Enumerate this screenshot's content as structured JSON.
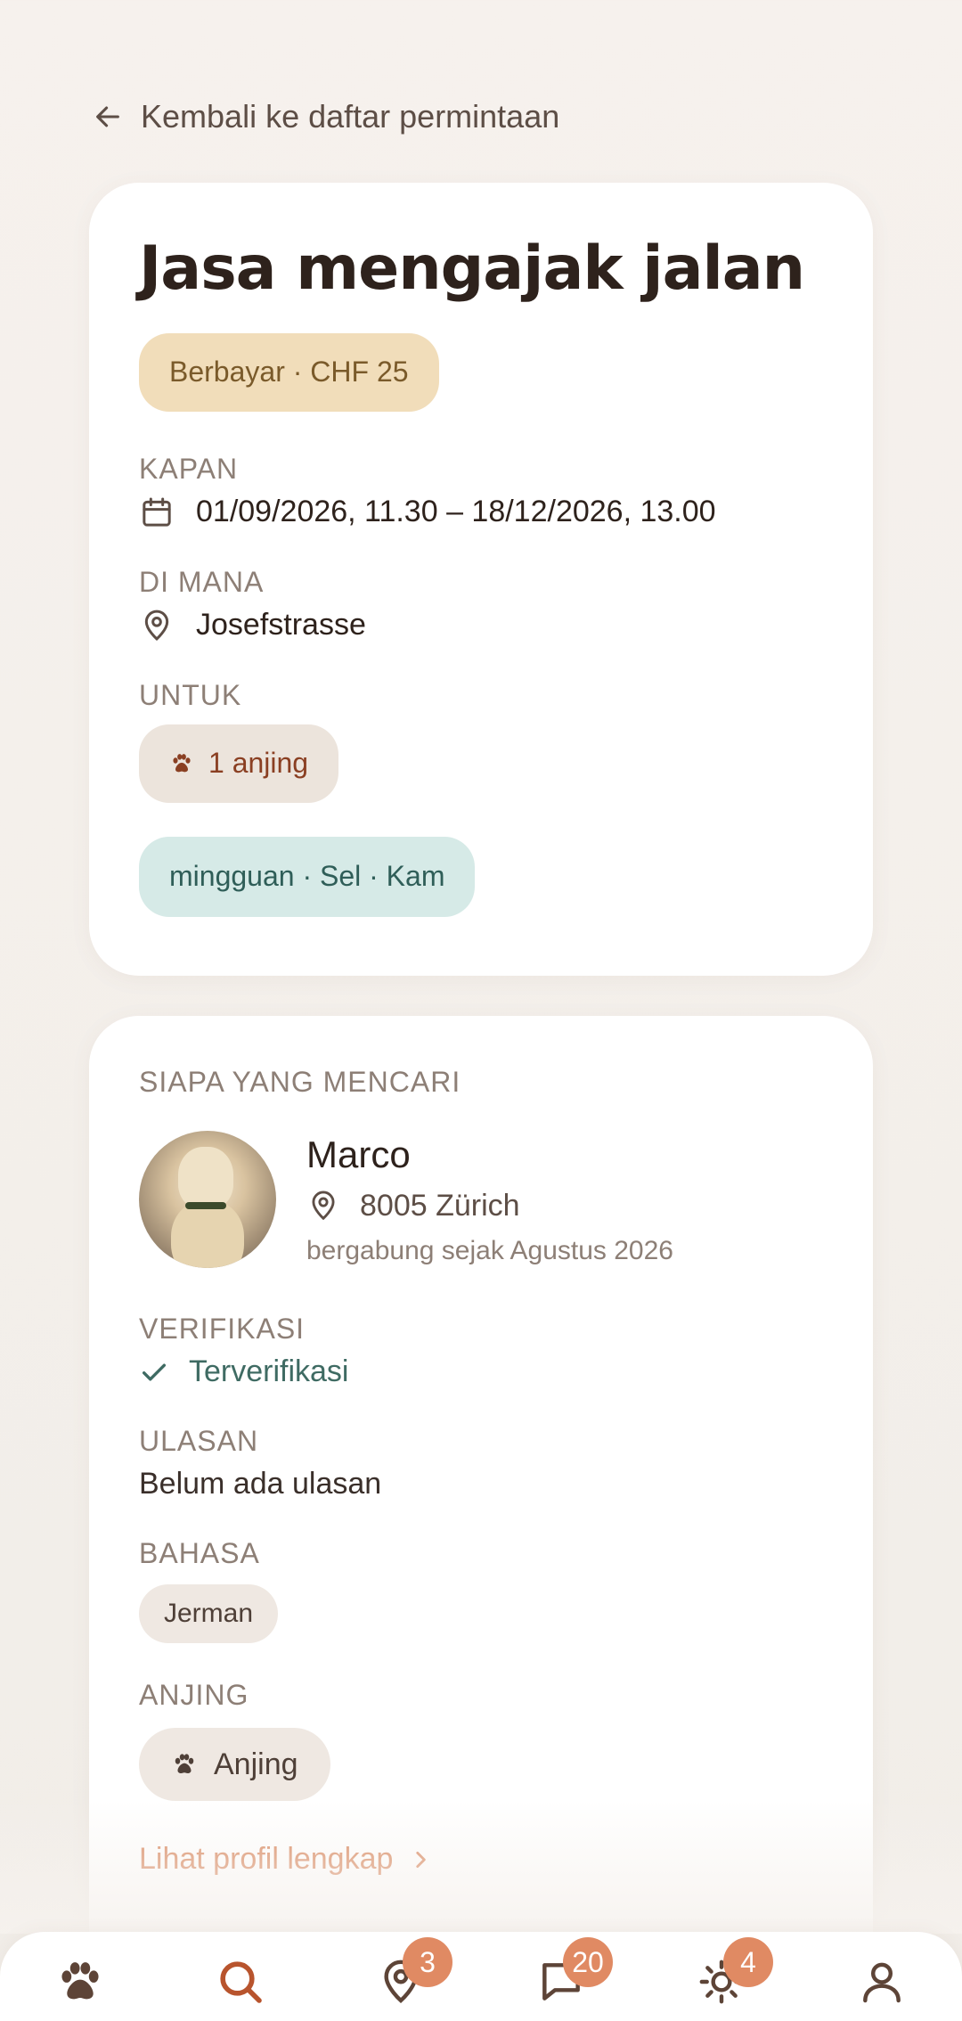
{
  "back_link": {
    "label": "Kembali ke daftar permintaan"
  },
  "request": {
    "title": "Jasa mengajak jalan",
    "price_pill": "Berbayar · CHF 25",
    "when_label": "KAPAN",
    "when_value": "01/09/2026, 11.30 – 18/12/2026, 13.00",
    "where_label": "DI MANA",
    "where_value": "Josefstrasse",
    "for_label": "UNTUK",
    "for_value": "1 anjing",
    "frequency_pill": "mingguan · Sel · Kam"
  },
  "profile": {
    "section_label": "SIAPA YANG MENCARI",
    "name": "Marco",
    "location": "8005 Zürich",
    "member_since": "bergabung sejak Agustus 2026",
    "verification_label": "VERIFIKASI",
    "verification_value": "Terverifikasi",
    "reviews_label": "ULASAN",
    "reviews_value": "Belum ada ulasan",
    "language_label": "BAHASA",
    "languages": [
      "Jerman"
    ],
    "dogs_label": "ANJING",
    "dogs_value": "Anjing",
    "full_profile_link": "Lihat profil lengkap"
  },
  "bottom_nav": {
    "items": [
      {
        "icon": "paw-icon",
        "badge": ""
      },
      {
        "icon": "search-icon",
        "badge": ""
      },
      {
        "icon": "map-pin-icon",
        "badge": "3"
      },
      {
        "icon": "chat-icon",
        "badge": "20"
      },
      {
        "icon": "sun-icon",
        "badge": "4"
      },
      {
        "icon": "user-icon",
        "badge": ""
      }
    ]
  },
  "colors": {
    "accent": "#e08a63",
    "price_pill_bg": "#f1ddba",
    "frequency_pill_bg": "#d6eae7",
    "verified": "#3f6b63"
  }
}
